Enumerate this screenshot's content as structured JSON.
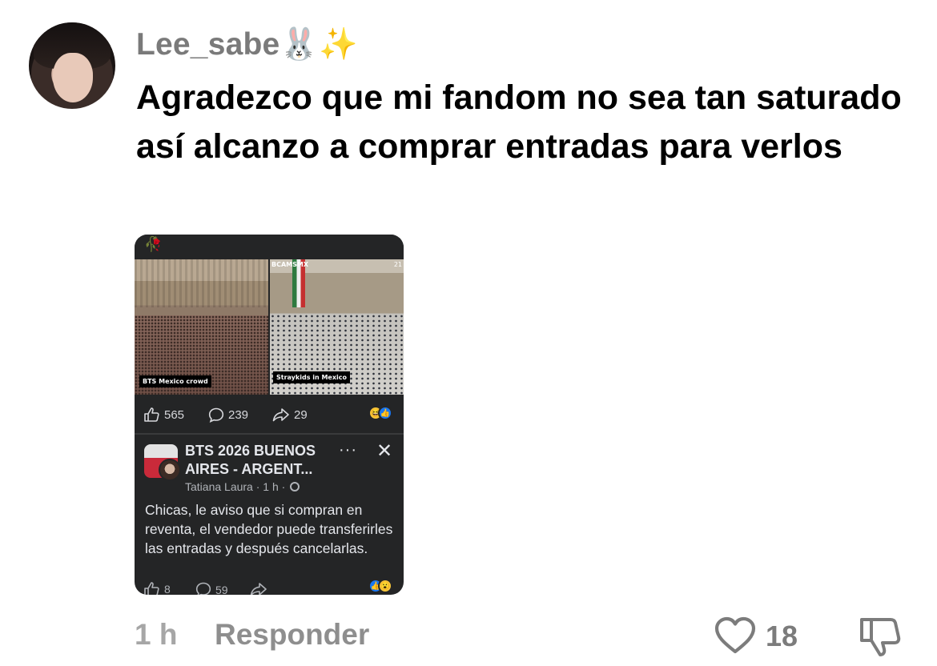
{
  "comment": {
    "username": "Lee_sabe🐰✨",
    "text": "Agradezco que mi fandom no sea tan saturado así alcanzo a comprar entradas para verlos",
    "time": "1 h",
    "reply_label": "Responder",
    "like_count": "18"
  },
  "screenshot": {
    "top_emoji": "🥀",
    "left_caption": "BTS Mexico crowd",
    "right_caption": "Straykids in Mexico",
    "right_overlay_left": "BCAMSMX",
    "right_overlay_right": "21",
    "reactions": {
      "likes": "565",
      "comments": "239",
      "shares": "29"
    },
    "post": {
      "title": "BTS 2026 BUENOS AIRES - ARGENT...",
      "author": "Tatiana Laura",
      "age": "· 1 h ·",
      "dots": "···",
      "close": "✕",
      "body": "Chicas, le aviso que si compran en reventa, el vendedor puede transferirles las entradas y después cancelarlas.",
      "likes": "8",
      "comments": "59"
    }
  },
  "colors": {
    "username": "#7a7a7a",
    "dark_bg": "#242526",
    "fb_text": "#e4e6eb",
    "fb_meta": "#b0b3b8",
    "like_blue": "#1877f2"
  }
}
